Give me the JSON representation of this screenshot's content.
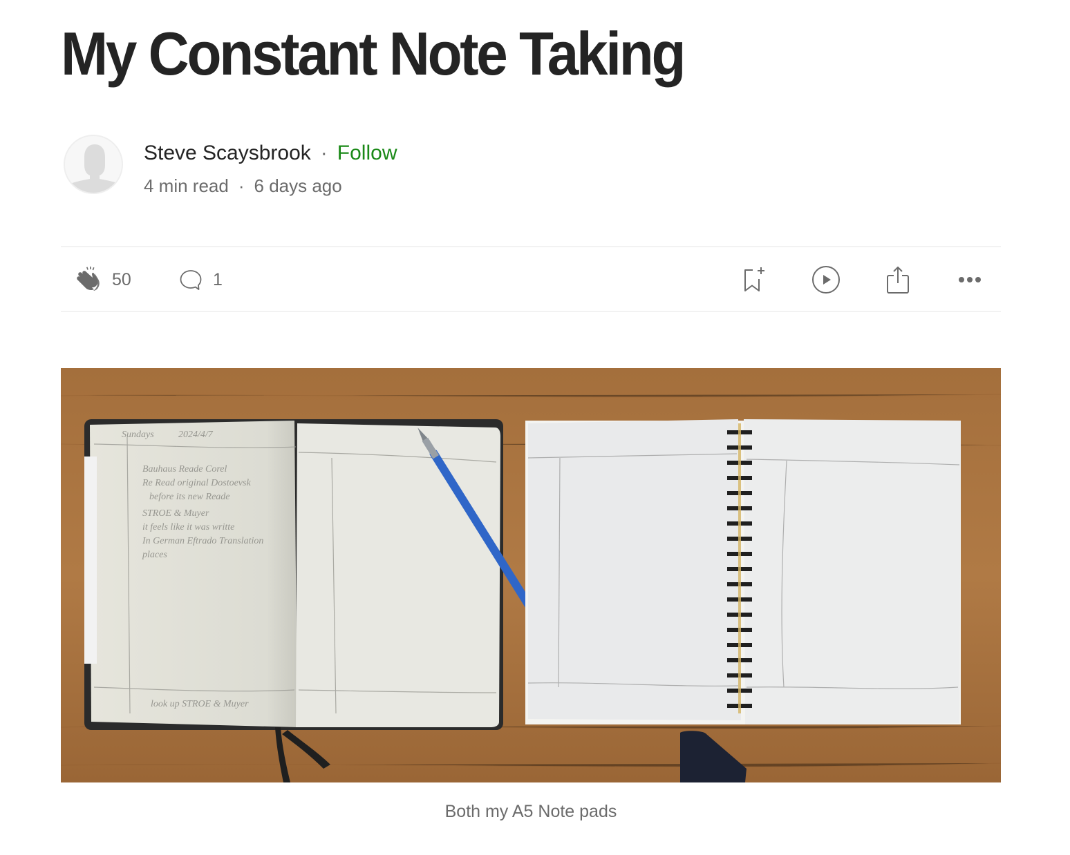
{
  "article": {
    "title": "My Constant Note Taking"
  },
  "author": {
    "name": "Steve Scaysbrook",
    "separator": "·",
    "follow_label": "Follow",
    "avatar_icon": "default-user-avatar"
  },
  "meta": {
    "read_time": "4 min read",
    "separator": "·",
    "published": "6 days ago"
  },
  "actions": {
    "claps": {
      "icon": "clap-icon",
      "count": "50"
    },
    "responses": {
      "icon": "comment-icon",
      "count": "1"
    },
    "save": {
      "icon": "bookmark-add-icon"
    },
    "listen": {
      "icon": "play-icon"
    },
    "share": {
      "icon": "share-icon"
    },
    "more": {
      "icon": "more-icon"
    }
  },
  "figure": {
    "description": "Two open A5 notebooks on a wooden desk with a blue mechanical pencil",
    "caption": "Both my A5 Note pads"
  },
  "colors": {
    "text": "#242424",
    "muted": "#6b6b6b",
    "follow": "#1a8917",
    "divider": "#f2f2f2"
  }
}
